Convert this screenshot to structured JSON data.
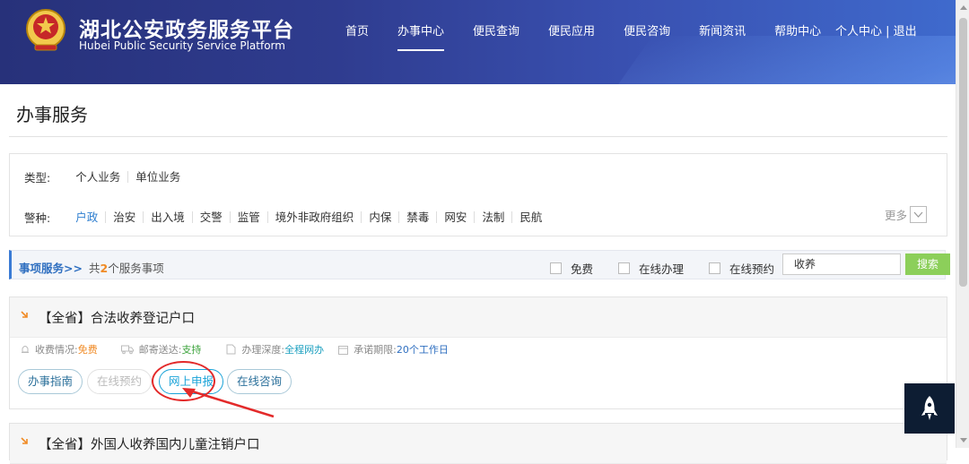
{
  "header": {
    "title": "湖北公安政务服务平台",
    "subtitle": "Hubei Public Security Service Platform",
    "nav": [
      {
        "label": "首页"
      },
      {
        "label": "办事中心"
      },
      {
        "label": "便民查询"
      },
      {
        "label": "便民应用"
      },
      {
        "label": "便民咨询"
      },
      {
        "label": "新闻资讯"
      },
      {
        "label": "帮助中心"
      }
    ],
    "user": "个人中心 | 退出"
  },
  "page_title": "办事服务",
  "filters": {
    "type_label": "类型:",
    "types": [
      "个人业务",
      "单位业务"
    ],
    "police_label": "警种:",
    "police_types": [
      "户政",
      "治安",
      "出入境",
      "交警",
      "监管",
      "境外非政府组织",
      "内保",
      "禁毒",
      "网安",
      "法制",
      "民航"
    ],
    "more_label": "更多"
  },
  "service_bar": {
    "title": "事项服务>>",
    "count_prefix": "共",
    "count": "2",
    "count_suffix": "个服务事项",
    "checkbox_free": "免费",
    "checkbox_online": "在线办理",
    "checkbox_booking": "在线预约",
    "search_value": "收养",
    "search_button": "搜索"
  },
  "items": [
    {
      "title": "【全省】合法收养登记户口",
      "fee_label": "收费情况:",
      "fee_value": "免费",
      "mail_label": "邮寄送达:",
      "mail_value": "支持",
      "depth_label": "办理深度:",
      "depth_value": "全程网办",
      "limit_label": "承诺期限:",
      "limit_value": "20个工作日",
      "buttons": {
        "guide": "办事指南",
        "booking": "在线预约",
        "apply": "网上申报",
        "consult": "在线咨询"
      }
    },
    {
      "title": "【全省】外国人收养国内儿童注销户口"
    }
  ],
  "colors": {
    "accent": "#2f7fd0",
    "search_button": "#8ccf5a",
    "annotation": "#e32a2a"
  }
}
